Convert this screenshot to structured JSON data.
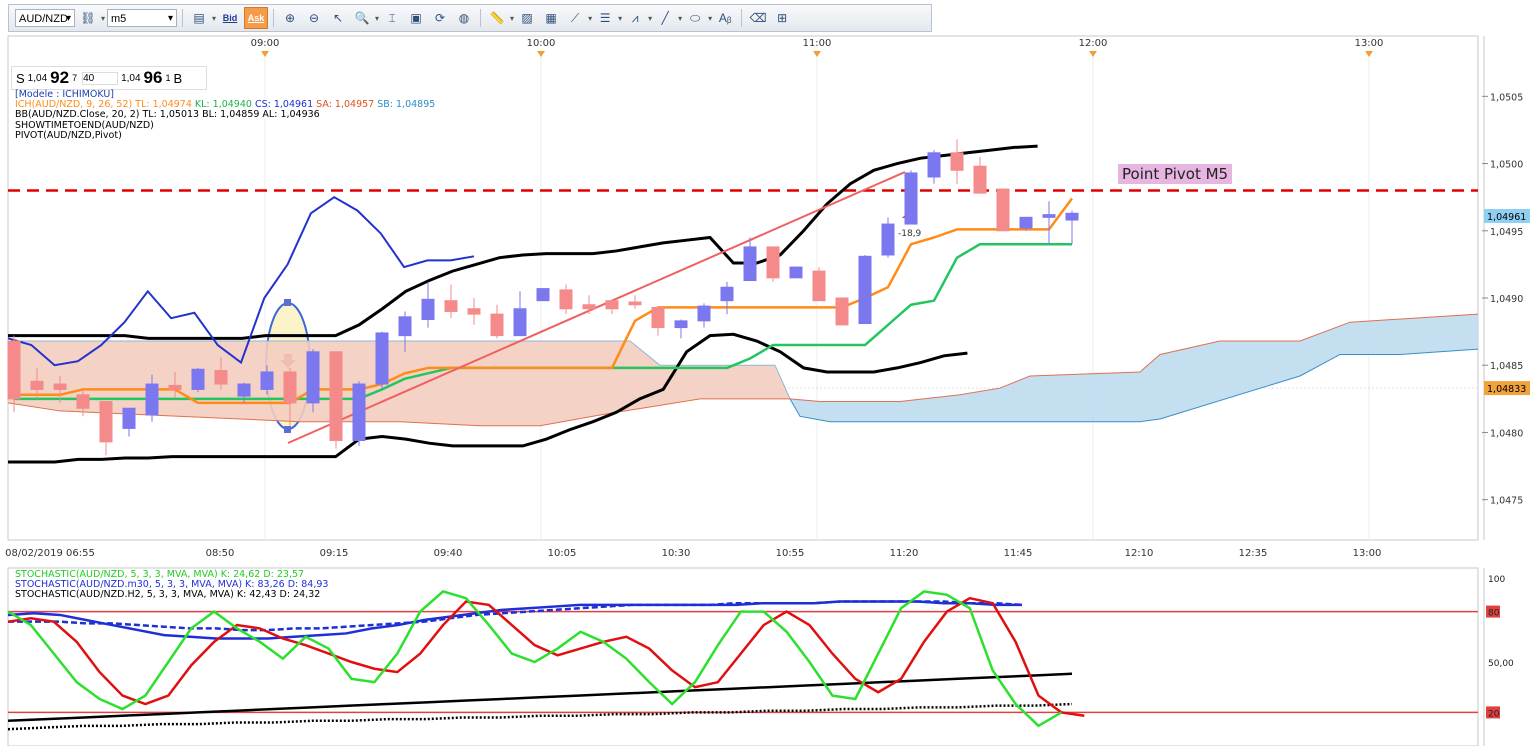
{
  "toolbar": {
    "symbol": "AUD/NZD",
    "timeframe": "m5",
    "bid_label": "Bid",
    "ask_label": "Ask"
  },
  "quote": {
    "sell_prefix": "S",
    "sell_pip_prefix": "1,04",
    "sell_big": "92",
    "sell_sup": "7",
    "spread": "40",
    "buy_pip_prefix": "1,04",
    "buy_big": "96",
    "buy_sup": "1",
    "buy_suffix": "B"
  },
  "legend": {
    "modele": "[Modele : ICHIMOKU]",
    "ich": "ICH(AUD/NZD, 9, 26, 52)",
    "ich_tl": "TL: 1,04974",
    "ich_kl": "KL: 1,04940",
    "ich_cs": "CS: 1,04961",
    "ich_sa": "SA: 1,04957",
    "ich_sb": "SB: 1,04895",
    "bb": "BB(AUD/NZD.Close, 20, 2)  TL: 1,05013  BL: 1,04859  AL: 1,04936",
    "show": "SHOWTIMETOEND(AUD/NZD)",
    "pivot": "PIVOT(AUD/NZD,Pivot)"
  },
  "stoch_legend": {
    "s1": "STOCHASTIC(AUD/NZD, 5, 3, 3, MVA, MVA)  K: 24,62  D: 23,57",
    "s2": "STOCHASTIC(AUD/NZD.m30, 5, 3, 3, MVA, MVA)  K: 83,26  D: 84,93",
    "s3": "STOCHASTIC(AUD/NZD.H2, 5, 3, 3, MVA, MVA)  K: 42,43  D: 24,32"
  },
  "pivot_label": "Point Pivot M5",
  "annotation_value": "-18,9",
  "colors": {
    "bull": "#7b77ef",
    "bear": "#f48a8a",
    "tenkan": "#ff8c1a",
    "kijun": "#22c55e",
    "bollinger": "#000000",
    "chikou": "#2233cc",
    "pivot": "#e00000",
    "kumo_bear": "#f3cdbf",
    "kumo_bull": "#bcdcee"
  },
  "chart_data": {
    "type": "candlestick",
    "symbol": "AUD/NZD",
    "timeframe": "m5",
    "top_time_ticks": [
      "09:00",
      "10:00",
      "11:00",
      "12:00",
      "13:00"
    ],
    "bottom_time_ticks": [
      "08/02/2019 06:55",
      "08:50",
      "09:15",
      "09:40",
      "10:05",
      "10:30",
      "10:55",
      "11:20",
      "11:45",
      "12:10",
      "12:35",
      "13:00"
    ],
    "price_ticks": [
      "1,0505",
      "1,0500",
      "1,0495",
      "1,0490",
      "1,0485",
      "1,0480",
      "1,0475"
    ],
    "ylim": [
      1.0472,
      1.0508
    ],
    "pivot_level": 1.0498,
    "current_price_label": "1,04961",
    "kumo_edge_label": "1,04833",
    "candles": [
      {
        "o": 1.04868,
        "h": 1.04872,
        "c": 1.04825,
        "l": 1.04815
      },
      {
        "o": 1.04838,
        "h": 1.04848,
        "c": 1.04832,
        "l": 1.04825
      },
      {
        "o": 1.04836,
        "h": 1.04842,
        "c": 1.04832,
        "l": 1.04822
      },
      {
        "o": 1.04828,
        "h": 1.04832,
        "c": 1.04818,
        "l": 1.04812
      },
      {
        "o": 1.04823,
        "h": 1.04823,
        "c": 1.04793,
        "l": 1.04783
      },
      {
        "o": 1.04803,
        "h": 1.04817,
        "c": 1.04818,
        "l": 1.04797
      },
      {
        "o": 1.04813,
        "h": 1.04843,
        "c": 1.04836,
        "l": 1.04808
      },
      {
        "o": 1.04835,
        "h": 1.04845,
        "c": 1.04832,
        "l": 1.04826
      },
      {
        "o": 1.04832,
        "h": 1.04848,
        "c": 1.04847,
        "l": 1.0483
      },
      {
        "o": 1.04846,
        "h": 1.04856,
        "c": 1.04836,
        "l": 1.04832
      },
      {
        "o": 1.04827,
        "h": 1.04837,
        "c": 1.04836,
        "l": 1.04822
      },
      {
        "o": 1.04832,
        "h": 1.0485,
        "c": 1.04845,
        "l": 1.04828
      },
      {
        "o": 1.04845,
        "h": 1.04848,
        "c": 1.04822,
        "l": 1.04805
      },
      {
        "o": 1.04822,
        "h": 1.04862,
        "c": 1.0486,
        "l": 1.04815
      },
      {
        "o": 1.0486,
        "h": 1.0486,
        "c": 1.04794,
        "l": 1.04788
      },
      {
        "o": 1.04794,
        "h": 1.04838,
        "c": 1.04836,
        "l": 1.0479
      },
      {
        "o": 1.04836,
        "h": 1.04875,
        "c": 1.04874,
        "l": 1.04832
      },
      {
        "o": 1.04872,
        "h": 1.0489,
        "c": 1.04886,
        "l": 1.0486
      },
      {
        "o": 1.04884,
        "h": 1.04912,
        "c": 1.04899,
        "l": 1.04878
      },
      {
        "o": 1.04898,
        "h": 1.0491,
        "c": 1.0489,
        "l": 1.04885
      },
      {
        "o": 1.04892,
        "h": 1.049,
        "c": 1.04888,
        "l": 1.0488
      },
      {
        "o": 1.04888,
        "h": 1.04895,
        "c": 1.04872,
        "l": 1.0487
      },
      {
        "o": 1.04872,
        "h": 1.04905,
        "c": 1.04892,
        "l": 1.04872
      },
      {
        "o": 1.04898,
        "h": 1.04907,
        "c": 1.04907,
        "l": 1.04898
      },
      {
        "o": 1.04906,
        "h": 1.0491,
        "c": 1.04892,
        "l": 1.04888
      },
      {
        "o": 1.04895,
        "h": 1.04902,
        "c": 1.04892,
        "l": 1.04888
      },
      {
        "o": 1.04898,
        "h": 1.04898,
        "c": 1.04892,
        "l": 1.04888
      },
      {
        "o": 1.04897,
        "h": 1.04902,
        "c": 1.04895,
        "l": 1.04892
      },
      {
        "o": 1.04893,
        "h": 1.04894,
        "c": 1.04878,
        "l": 1.04872
      },
      {
        "o": 1.04878,
        "h": 1.04884,
        "c": 1.04883,
        "l": 1.0487
      },
      {
        "o": 1.04883,
        "h": 1.04896,
        "c": 1.04894,
        "l": 1.04878
      },
      {
        "o": 1.04898,
        "h": 1.04912,
        "c": 1.04908,
        "l": 1.04888
      },
      {
        "o": 1.04913,
        "h": 1.04945,
        "c": 1.04938,
        "l": 1.04913
      },
      {
        "o": 1.04938,
        "h": 1.04938,
        "c": 1.04915,
        "l": 1.04912
      },
      {
        "o": 1.04915,
        "h": 1.04922,
        "c": 1.04923,
        "l": 1.04915
      },
      {
        "o": 1.0492,
        "h": 1.04923,
        "c": 1.04898,
        "l": 1.04898
      },
      {
        "o": 1.049,
        "h": 1.049,
        "c": 1.0488,
        "l": 1.0488
      },
      {
        "o": 1.04881,
        "h": 1.04932,
        "c": 1.04931,
        "l": 1.04881
      },
      {
        "o": 1.04932,
        "h": 1.0496,
        "c": 1.04955,
        "l": 1.0493
      },
      {
        "o": 1.04955,
        "h": 1.04995,
        "c": 1.04993,
        "l": 1.04955
      },
      {
        "o": 1.0499,
        "h": 1.0501,
        "c": 1.05008,
        "l": 1.04985
      },
      {
        "o": 1.05008,
        "h": 1.05018,
        "c": 1.04995,
        "l": 1.04985
      },
      {
        "o": 1.04998,
        "h": 1.05005,
        "c": 1.04978,
        "l": 1.04978
      },
      {
        "o": 1.04981,
        "h": 1.04981,
        "c": 1.0495,
        "l": 1.0495
      },
      {
        "o": 1.04952,
        "h": 1.0496,
        "c": 1.0496,
        "l": 1.0495
      },
      {
        "o": 1.0496,
        "h": 1.04972,
        "c": 1.04962,
        "l": 1.0494
      },
      {
        "o": 1.04958,
        "h": 1.04965,
        "c": 1.04963,
        "l": 1.0494
      }
    ],
    "series": [
      {
        "name": "ICH TL",
        "color": "tenkan",
        "values": [
          1.04828,
          1.04828,
          1.04828,
          1.04832,
          1.04832,
          1.04832,
          1.04832,
          1.04832,
          1.04822,
          1.04822,
          1.04822,
          1.04822,
          1.04822,
          1.04832,
          1.04832,
          1.04832,
          1.04836,
          1.04844,
          1.04848,
          1.04848,
          1.04848,
          1.04848,
          1.04848,
          1.04848,
          1.04848,
          1.04848,
          1.04848,
          1.04883,
          1.04893,
          1.04893,
          1.04893,
          1.04893,
          1.04893,
          1.04893,
          1.04893,
          1.04893,
          1.04893,
          1.049,
          1.04908,
          1.0494,
          1.04945,
          1.04951,
          1.04951,
          1.04951,
          1.04951,
          1.04951,
          1.04974
        ]
      },
      {
        "name": "ICH KL",
        "color": "kijun",
        "values": [
          1.04825,
          1.04825,
          1.04825,
          1.04825,
          1.04825,
          1.04825,
          1.04825,
          1.04825,
          1.04825,
          1.04825,
          1.04825,
          1.04825,
          1.04825,
          1.04825,
          1.04825,
          1.04825,
          1.04832,
          1.0484,
          1.04844,
          1.04848,
          1.04848,
          1.04848,
          1.04848,
          1.04848,
          1.04848,
          1.04848,
          1.04848,
          1.04848,
          1.04848,
          1.04848,
          1.04848,
          1.04848,
          1.04855,
          1.04865,
          1.04865,
          1.04865,
          1.04865,
          1.04865,
          1.0488,
          1.04895,
          1.04898,
          1.0493,
          1.0494,
          1.0494,
          1.0494,
          1.0494,
          1.0494
        ]
      },
      {
        "name": "BB TL",
        "color": "bollinger",
        "values": [
          1.04872,
          1.04872,
          1.04872,
          1.04872,
          1.04872,
          1.04872,
          1.0487,
          1.0487,
          1.0487,
          1.0487,
          1.0487,
          1.04872,
          1.04872,
          1.04872,
          1.04872,
          1.0488,
          1.04892,
          1.04905,
          1.04913,
          1.0492,
          1.04925,
          1.0493,
          1.04932,
          1.04933,
          1.04933,
          1.04933,
          1.04935,
          1.04938,
          1.04941,
          1.04943,
          1.04945,
          1.04926,
          1.04926,
          1.04932,
          1.0495,
          1.0497,
          1.04985,
          1.04995,
          1.05,
          1.05004,
          1.05006,
          1.05008,
          1.0501,
          1.05012,
          1.05013
        ]
      },
      {
        "name": "BB BL",
        "color": "bollinger",
        "values": [
          1.04778,
          1.04778,
          1.04778,
          1.0478,
          1.0478,
          1.04781,
          1.04781,
          1.04782,
          1.04782,
          1.04782,
          1.04782,
          1.04782,
          1.04782,
          1.04782,
          1.04782,
          1.04795,
          1.04797,
          1.04795,
          1.04792,
          1.0479,
          1.0479,
          1.0479,
          1.0479,
          1.04795,
          1.04802,
          1.04808,
          1.04815,
          1.04825,
          1.04832,
          1.0486,
          1.04872,
          1.04873,
          1.04868,
          1.0486,
          1.04848,
          1.04845,
          1.04845,
          1.04845,
          1.04848,
          1.04852,
          1.04857,
          1.04859
        ]
      },
      {
        "name": "ICH CS",
        "color": "chikou",
        "values": [
          1.049,
          1.04895,
          1.0488,
          1.04883,
          1.04895,
          1.04912,
          1.04935,
          1.04915,
          1.04919,
          1.04895,
          1.04882,
          1.0493,
          1.04955,
          1.04993,
          1.05005,
          1.04995,
          1.04978,
          1.04953,
          1.04958,
          1.04958,
          1.04961
        ]
      }
    ],
    "stochastic_panel": {
      "ylim": [
        0,
        100
      ],
      "ticks": [
        "100",
        "80",
        "50,00",
        "20"
      ],
      "levels": [
        80,
        20
      ],
      "series": [
        {
          "name": "STOCHASTIC(AUD/NZD, 5, 3, 3, MVA, MVA) K",
          "color": "#2ee02e",
          "values": [
            80,
            72,
            55,
            38,
            28,
            22,
            30,
            50,
            70,
            80,
            70,
            62,
            52,
            65,
            58,
            40,
            38,
            55,
            80,
            92,
            88,
            72,
            55,
            50,
            58,
            68,
            62,
            52,
            38,
            25,
            38,
            60,
            80,
            80,
            68,
            50,
            30,
            28,
            55,
            82,
            92,
            90,
            82,
            45,
            25,
            12,
            20
          ]
        },
        {
          "name": "STOCHASTIC(AUD/NZD, 5, 3, 3, MVA, MVA) D",
          "color": "#e01010",
          "values": [
            74,
            76,
            74,
            62,
            44,
            30,
            25,
            30,
            48,
            62,
            72,
            70,
            64,
            60,
            55,
            50,
            46,
            44,
            55,
            72,
            86,
            84,
            72,
            60,
            54,
            58,
            62,
            65,
            58,
            45,
            35,
            38,
            55,
            72,
            80,
            72,
            55,
            40,
            32,
            40,
            62,
            80,
            88,
            85,
            62,
            30,
            20,
            18
          ]
        },
        {
          "name": "STOCHASTIC(AUD/NZD.m30) K",
          "color": "#1f2fd6",
          "values": [
            78,
            79,
            78,
            75,
            72,
            69,
            66,
            65,
            64,
            64,
            64,
            65,
            66,
            67,
            70,
            72,
            75,
            77,
            79,
            81,
            82,
            83,
            84,
            84,
            84,
            84,
            84,
            84,
            84,
            85,
            85,
            85,
            86,
            86,
            86,
            86,
            85,
            85,
            84,
            84
          ]
        },
        {
          "name": "STOCHASTIC(AUD/NZD.m30) D",
          "color": "#1f2fd6",
          "values": [
            74,
            74,
            74,
            73,
            73,
            72,
            71,
            70,
            70,
            69,
            69,
            70,
            70,
            71,
            72,
            73,
            74,
            76,
            78,
            79,
            80,
            81,
            82,
            83,
            84,
            84,
            84,
            84,
            85,
            85,
            85,
            85,
            86,
            86,
            86,
            86,
            86,
            85,
            85,
            84
          ]
        },
        {
          "name": "STOCHASTIC(AUD/NZD.H2) K",
          "color": "#000000",
          "values": [
            15,
            16,
            17,
            18,
            19,
            20,
            21,
            22,
            23,
            24,
            25,
            26,
            27,
            28,
            29,
            30,
            31,
            32,
            33,
            34,
            35,
            36,
            37,
            38,
            39,
            40,
            41,
            42,
            43
          ]
        },
        {
          "name": "STOCHASTIC(AUD/NZD.H2) D",
          "color": "#000000",
          "values": [
            10,
            11,
            12,
            12,
            13,
            13,
            14,
            14,
            15,
            15,
            16,
            16,
            17,
            17,
            18,
            18,
            19,
            19,
            20,
            20,
            21,
            21,
            22,
            22,
            23,
            23,
            24,
            24,
            25
          ]
        }
      ]
    }
  }
}
